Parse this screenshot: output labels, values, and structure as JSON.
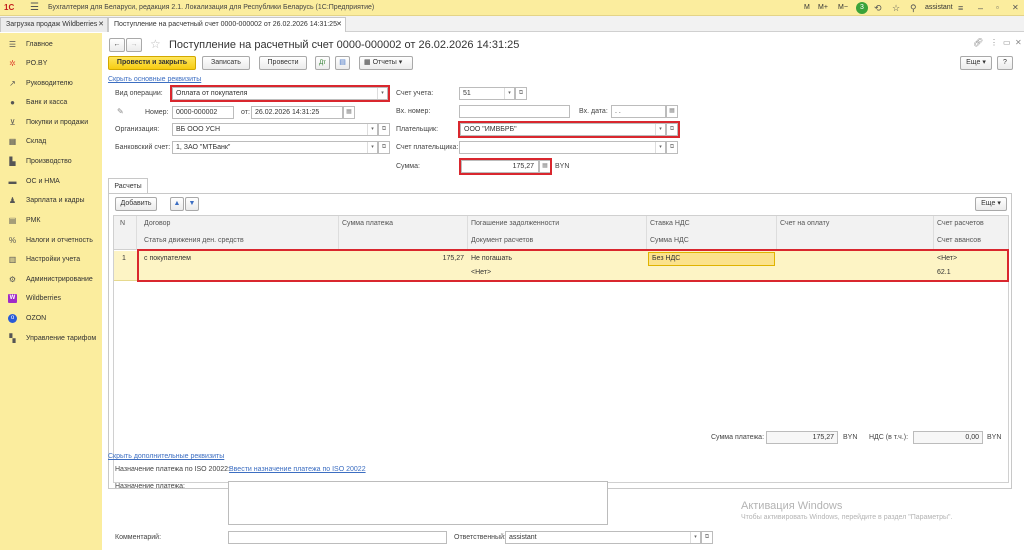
{
  "app": {
    "logo": "1С",
    "title": "Бухгалтерия для Беларуси, редакция 2.1. Локализация для Республики Беларусь (1С:Предприятие)",
    "top_right": {
      "m": "M",
      "mplus": "M+",
      "mminus": "M−",
      "badge_count": "3",
      "user": "assistant"
    }
  },
  "tabs": [
    {
      "label": "Загрузка продаж Wildberries"
    },
    {
      "label": "Поступление на расчетный счет 0000-000002 от 26.02.2026 14:31:25"
    }
  ],
  "sidebar": {
    "items": [
      {
        "label": "Главное",
        "icon": "menu-icon"
      },
      {
        "label": "PO.BY",
        "icon": "snowflake-icon"
      },
      {
        "label": "Руководителю",
        "icon": "chart-icon"
      },
      {
        "label": "Банк и касса",
        "icon": "bank-icon"
      },
      {
        "label": "Покупки и продажи",
        "icon": "cart-icon"
      },
      {
        "label": "Склад",
        "icon": "warehouse-icon"
      },
      {
        "label": "Производство",
        "icon": "factory-icon"
      },
      {
        "label": "ОС и НМА",
        "icon": "truck-icon"
      },
      {
        "label": "Зарплата и кадры",
        "icon": "person-icon"
      },
      {
        "label": "РМК",
        "icon": "register-icon"
      },
      {
        "label": "Налоги и отчетность",
        "icon": "percent-icon"
      },
      {
        "label": "Настройки учета",
        "icon": "settings-doc-icon"
      },
      {
        "label": "Администрирование",
        "icon": "gear-icon"
      },
      {
        "label": "Wildberries",
        "icon": "wb-icon"
      },
      {
        "label": "OZON",
        "icon": "ozon-icon"
      },
      {
        "label": "Управление тарифом",
        "icon": "tariff-icon"
      }
    ]
  },
  "doc": {
    "title": "Поступление на расчетный счет 0000-000002 от 26.02.2026 14:31:25",
    "toolbar": {
      "post_close": "Провести и закрыть",
      "save": "Записать",
      "post": "Провести",
      "reports": "Отчеты",
      "more": "Еще",
      "help": "?"
    },
    "hide_main": "Скрыть основные реквизиты",
    "fields": {
      "op_type_label": "Вид операции:",
      "op_type": "Оплата от покупателя",
      "number_label": "Номер:",
      "number": "0000-000002",
      "date_label": "от:",
      "date": "26.02.2026 14:31:25",
      "org_label": "Организация:",
      "org": "ВБ ООО УСН",
      "bank_label": "Банковский счет:",
      "bank": "1, ЗАО \"МТБанк\"",
      "acc_label": "Счет учета:",
      "acc": "51",
      "inno_label": "Вх. номер:",
      "inno": "",
      "indate_label": "Вх. дата:",
      "indate": ". .",
      "payer_label": "Плательщик:",
      "payer": "ООО \"ИМВБРБ\"",
      "payer_acc_label": "Счет плательщика:",
      "payer_acc": "",
      "sum_label": "Сумма:",
      "sum": "175,27",
      "currency": "BYN"
    },
    "inner_tab": "Расчеты",
    "table_toolbar": {
      "add": "Добавить",
      "more": "Еще"
    },
    "table": {
      "headers_row1": [
        "N",
        "Договор",
        "Сумма платежа",
        "Погашение задолженности",
        "Ставка НДС",
        "Счет на оплату",
        "Счет расчетов"
      ],
      "headers_row2": [
        "Статья движения ден. средств",
        "Документ расчетов",
        "Сумма НДС",
        "Счет авансов"
      ],
      "rows": [
        {
          "n": "1",
          "contract": "с покупателем",
          "amount": "175,27",
          "repay": "Не погашать",
          "vat_rate": "Без НДС",
          "invoice": "",
          "settle_acc": "<Нет>",
          "cf_item": "",
          "settle_doc": "<Нет>",
          "vat_sum": "",
          "adv_acc": "62.1"
        }
      ]
    },
    "totals": {
      "sum_label": "Сумма платежа:",
      "sum": "175,27",
      "sum_cur": "BYN",
      "vat_label": "НДС (в т.ч.):",
      "vat": "0,00",
      "vat_cur": "BYN"
    },
    "extra": {
      "hide_extra": "Скрыть дополнительные реквизиты",
      "iso_label": "Назначение платежа по ISO 20022:",
      "iso_link": "Ввести назначение платежа по ISO 20022",
      "purpose_label": "Назначение платежа:",
      "purpose": "",
      "comment_label": "Комментарий:",
      "comment": "",
      "resp_label": "Ответственный:",
      "resp": "assistant"
    },
    "watermark": {
      "line1": "Активация Windows",
      "line2": "Чтобы активировать Windows, перейдите в раздел \"Параметры\"."
    }
  },
  "colors": {
    "accent_yellow": "#fbed9e",
    "highlight_red": "#d9272e",
    "row_highlight": "#fdf4c5",
    "link": "#3c6ec2"
  }
}
